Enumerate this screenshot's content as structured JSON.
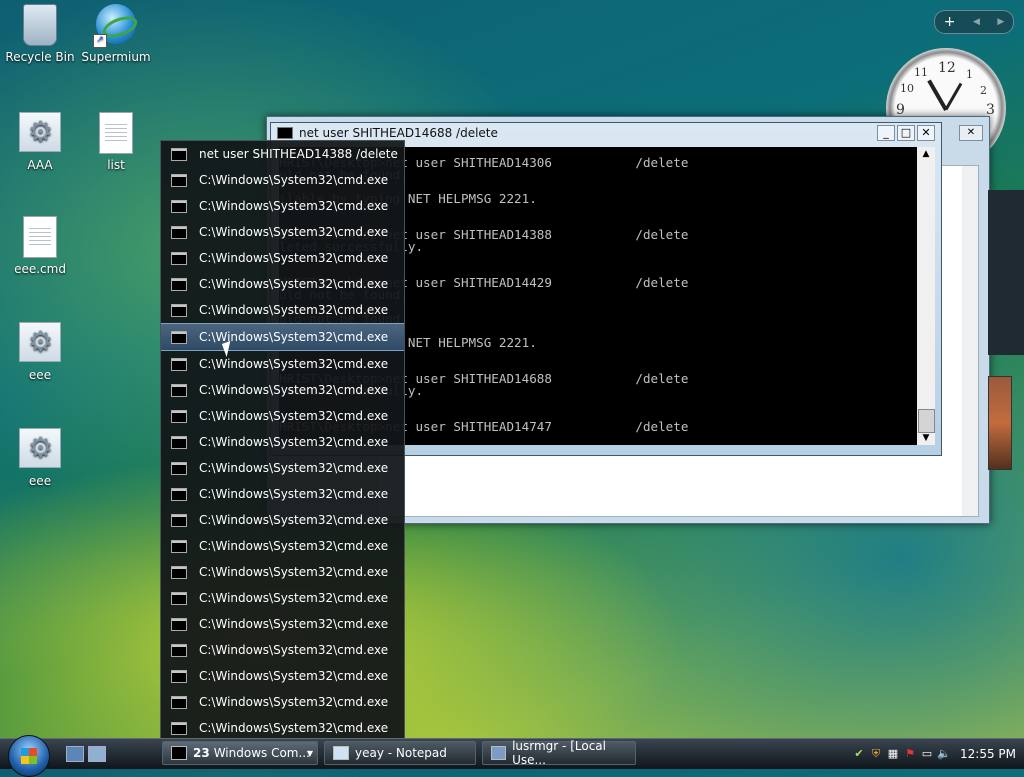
{
  "desktop": {
    "icons": [
      {
        "label": "Recycle Bin"
      },
      {
        "label": "Supermium"
      },
      {
        "label": "AAA"
      },
      {
        "label": "list"
      },
      {
        "label": "eee.cmd"
      },
      {
        "label": "eee"
      },
      {
        "label": "eee"
      }
    ]
  },
  "gadgets": {
    "controls": [
      "+",
      "◀",
      "▶"
    ],
    "clock_numbers": [
      "12",
      "3",
      "9",
      "1",
      "2",
      "10",
      "11"
    ]
  },
  "cmd_window": {
    "title": "net  user SHITHEAD14688 /delete",
    "buttons": [
      "_",
      "□",
      "✕"
    ],
    "lines": [
      "HRIST\\Desktop>net user SHITHEAD14306           /delete",
      "uld not be found.",
      "",
      "ilable by typing NET HELPMSG 2221.",
      "",
      "",
      "HRIST\\Desktop>net user SHITHEAD14388           /delete",
      "leted successfully.",
      "",
      "",
      "HRIST\\Desktop>net user SHITHEAD14429           /delete",
      "uld not be found.",
      "",
      "uld not be found.",
      "",
      "ilable by typing NET HELPMSG 2221.",
      "",
      "",
      "HRIST\\Desktop>net user SHITHEAD14688           /delete",
      "leted successfully.",
      "",
      "",
      "HRIST\\Desktop>net user SHITHEAD14747           /delete"
    ]
  },
  "jumplist": {
    "items": [
      "net  user SHITHEAD14388 /delete",
      "C:\\Windows\\System32\\cmd.exe",
      "C:\\Windows\\System32\\cmd.exe",
      "C:\\Windows\\System32\\cmd.exe",
      "C:\\Windows\\System32\\cmd.exe",
      "C:\\Windows\\System32\\cmd.exe",
      "C:\\Windows\\System32\\cmd.exe",
      "C:\\Windows\\System32\\cmd.exe",
      "C:\\Windows\\System32\\cmd.exe",
      "C:\\Windows\\System32\\cmd.exe",
      "C:\\Windows\\System32\\cmd.exe",
      "C:\\Windows\\System32\\cmd.exe",
      "C:\\Windows\\System32\\cmd.exe",
      "C:\\Windows\\System32\\cmd.exe",
      "C:\\Windows\\System32\\cmd.exe",
      "C:\\Windows\\System32\\cmd.exe",
      "C:\\Windows\\System32\\cmd.exe",
      "C:\\Windows\\System32\\cmd.exe",
      "C:\\Windows\\System32\\cmd.exe",
      "C:\\Windows\\System32\\cmd.exe",
      "C:\\Windows\\System32\\cmd.exe",
      "C:\\Windows\\System32\\cmd.exe",
      "C:\\Windows\\System32\\cmd.exe"
    ],
    "selected_index": 7
  },
  "taskbar": {
    "groups": [
      {
        "count": "23",
        "label": "Windows Com...",
        "icon": "cmd-icon"
      },
      {
        "label": "yeay - Notepad",
        "icon": "notepad-icon"
      },
      {
        "label": "lusrmgr - [Local Use...",
        "icon": "mmc-icon"
      }
    ],
    "clock": "12:55 PM"
  }
}
